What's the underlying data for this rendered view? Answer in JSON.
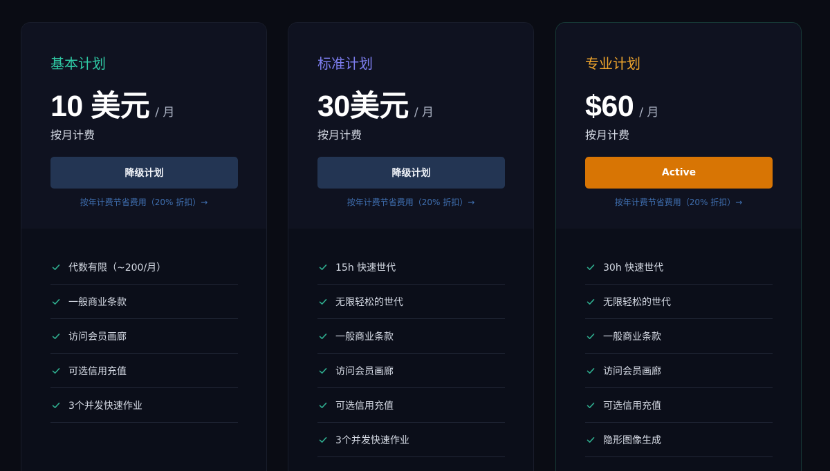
{
  "plans": [
    {
      "name": "基本计划",
      "name_color": "#2fc9a4",
      "price": "10 美元",
      "per": "/ 月",
      "billing": "按月计费",
      "button_label": "降级计划",
      "save_link": "按年计费节省费用（20% 折扣）→",
      "features": [
        "代数有限（~200/月）",
        "一般商业条款",
        "访问会员画廊",
        "可选信用充值",
        "3个并发快速作业"
      ]
    },
    {
      "name": "标准计划",
      "name_color": "#7d7ef0",
      "price": "30美元",
      "per": "/ 月",
      "billing": "按月计费",
      "button_label": "降级计划",
      "save_link": "按年计费节省费用（20% 折扣）→",
      "features": [
        "15h 快速世代",
        "无限轻松的世代",
        "一般商业条款",
        "访问会员画廊",
        "可选信用充值",
        "3个并发快速作业"
      ]
    },
    {
      "name": "专业计划",
      "name_color": "#f0a52c",
      "price": "$60",
      "per": "/ 月",
      "billing": "按月计费",
      "button_label": "Active",
      "button_active": true,
      "save_link": "按年计费节省费用（20% 折扣）→",
      "features": [
        "30h 快速世代",
        "无限轻松的世代",
        "一般商业条款",
        "访问会员画廊",
        "可选信用充值",
        "隐形图像生成"
      ]
    }
  ],
  "icons": {
    "feature_check": "check-icon"
  },
  "colors": {
    "check": "#2fae8f",
    "button_default": "#233553",
    "button_active": "#d87504",
    "link": "#3f6fb0"
  }
}
